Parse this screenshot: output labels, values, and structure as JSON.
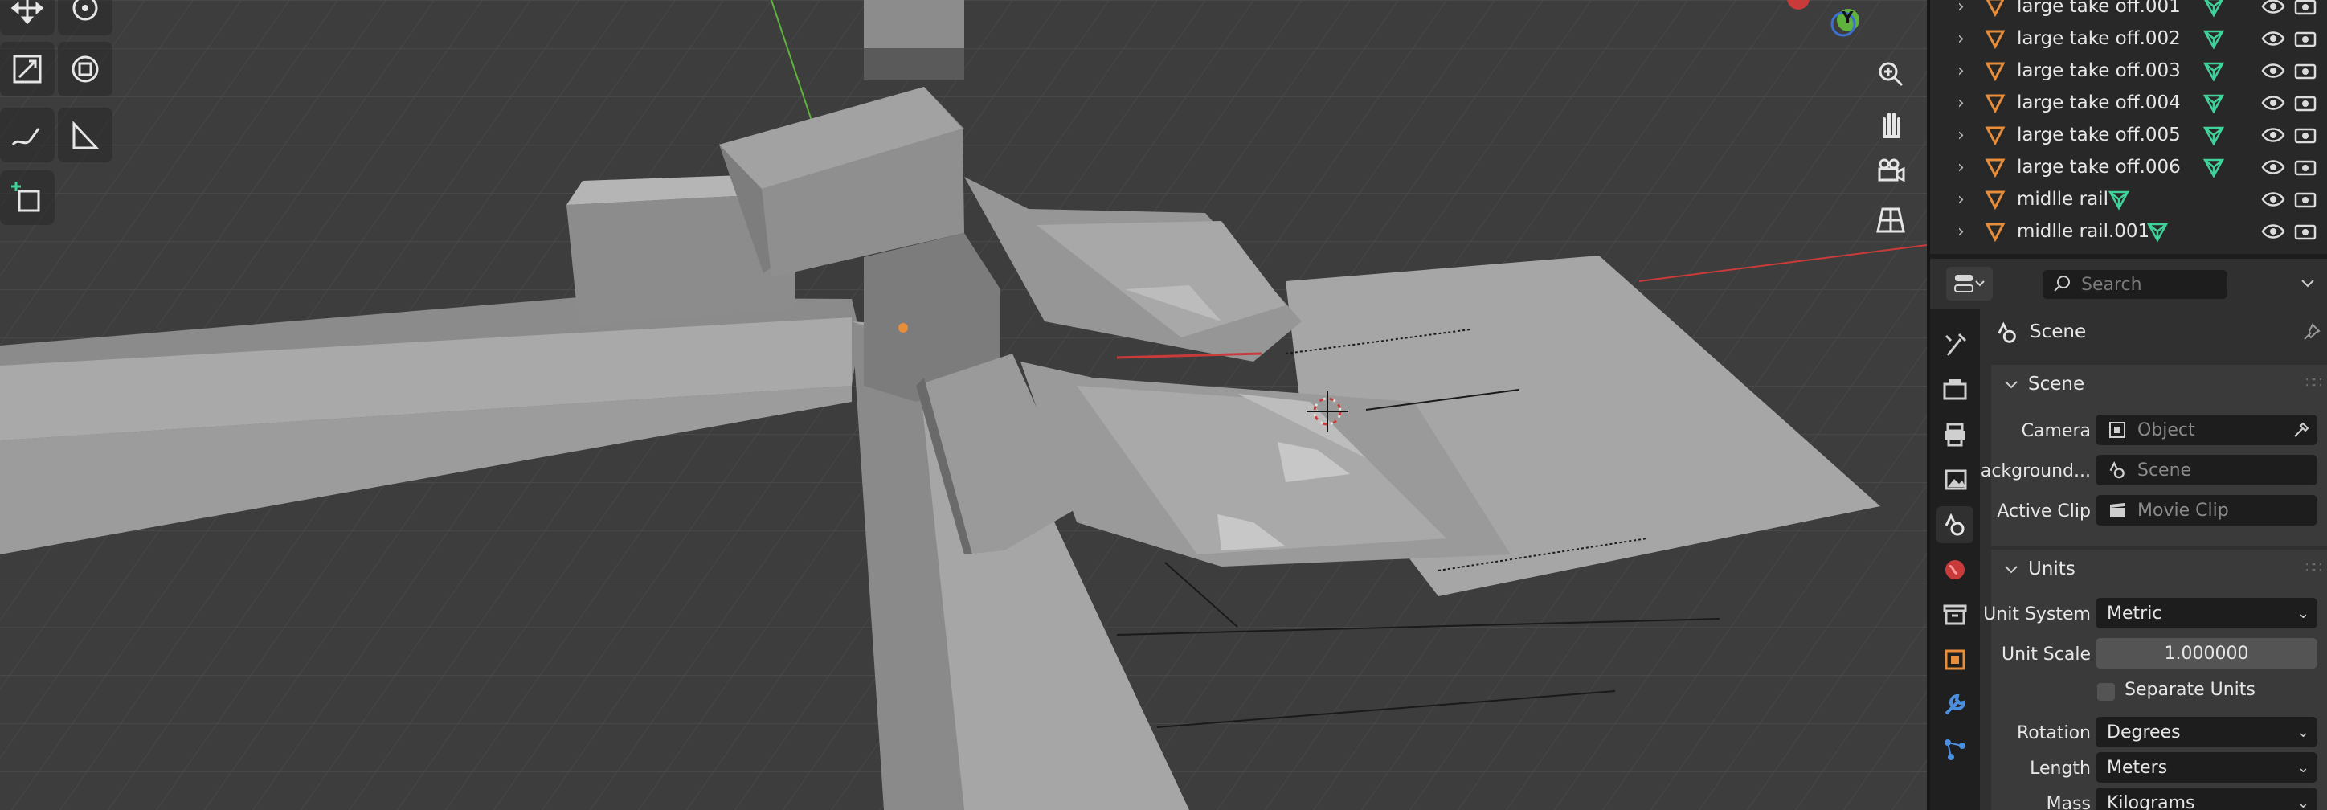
{
  "outliner": {
    "items": [
      {
        "name": "large take off.001"
      },
      {
        "name": "large take off.002"
      },
      {
        "name": "large take off.003"
      },
      {
        "name": "large take off.004"
      },
      {
        "name": "large take off.005"
      },
      {
        "name": "large take off.006"
      },
      {
        "name": "midlle rail"
      },
      {
        "name": "midlle rail.001"
      }
    ]
  },
  "properties": {
    "search_placeholder": "Search",
    "context_title": "Scene",
    "scene_panel": {
      "title": "Scene",
      "camera_label": "Camera",
      "camera_placeholder": "Object",
      "background_label": "Background...",
      "background_placeholder": "Scene",
      "active_clip_label": "Active Clip",
      "active_clip_placeholder": "Movie Clip"
    },
    "units_panel": {
      "title": "Units",
      "unit_system_label": "Unit System",
      "unit_system_value": "Metric",
      "unit_scale_label": "Unit Scale",
      "unit_scale_value": "1.000000",
      "separate_units_label": "Separate Units",
      "rotation_label": "Rotation",
      "rotation_value": "Degrees",
      "length_label": "Length",
      "length_value": "Meters",
      "mass_label": "Mass",
      "mass_value": "Kilograms"
    }
  },
  "gizmo": {
    "y_axis_label": "Y"
  },
  "colors": {
    "accent_orange": "#e88d3a",
    "mesh_green": "#3fd29a",
    "axis_red": "#c93b3b",
    "axis_green": "#5fb23c"
  }
}
